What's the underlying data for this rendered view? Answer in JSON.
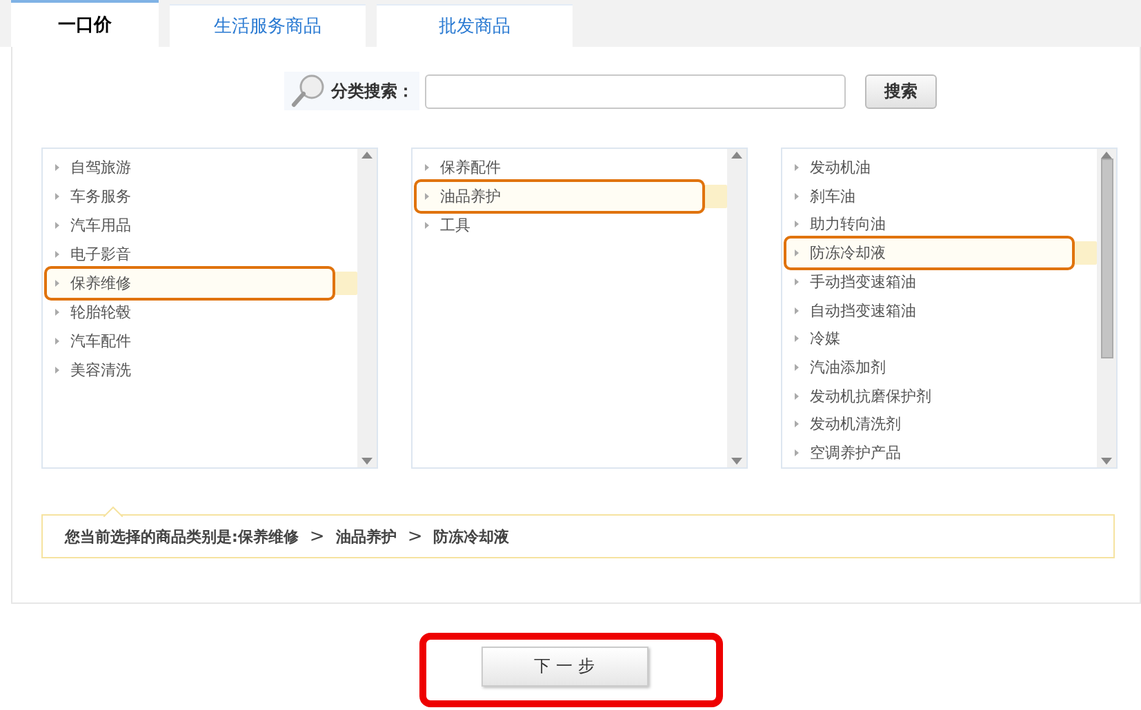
{
  "tabs": [
    {
      "label": "一口价",
      "selected": true
    },
    {
      "label": "生活服务商品",
      "selected": false
    },
    {
      "label": "批发商品",
      "selected": false
    }
  ],
  "search": {
    "label": "分类搜索：",
    "button": "搜索"
  },
  "columns": [
    {
      "scrollbar_thumb": false,
      "items": [
        {
          "label": "自驾旅游",
          "selected": false
        },
        {
          "label": "车务服务",
          "selected": false
        },
        {
          "label": "汽车用品",
          "selected": false
        },
        {
          "label": "电子影音",
          "selected": false
        },
        {
          "label": "保养维修",
          "selected": true
        },
        {
          "label": "轮胎轮毂",
          "selected": false
        },
        {
          "label": "汽车配件",
          "selected": false
        },
        {
          "label": "美容清洗",
          "selected": false
        }
      ]
    },
    {
      "scrollbar_thumb": false,
      "items": [
        {
          "label": "保养配件",
          "selected": false
        },
        {
          "label": "油品养护",
          "selected": true
        },
        {
          "label": "工具",
          "selected": false
        }
      ]
    },
    {
      "scrollbar_thumb": true,
      "items": [
        {
          "label": "发动机油",
          "selected": false
        },
        {
          "label": "刹车油",
          "selected": false
        },
        {
          "label": "助力转向油",
          "selected": false
        },
        {
          "label": "防冻冷却液",
          "selected": true
        },
        {
          "label": "手动挡变速箱油",
          "selected": false
        },
        {
          "label": "自动挡变速箱油",
          "selected": false
        },
        {
          "label": "冷媒",
          "selected": false
        },
        {
          "label": "汽油添加剂",
          "selected": false
        },
        {
          "label": "发动机抗磨保护剂",
          "selected": false
        },
        {
          "label": "发动机清洗剂",
          "selected": false
        },
        {
          "label": "空调养护产品",
          "selected": false
        }
      ]
    }
  ],
  "breadcrumb": [
    {
      "kind": "label",
      "text": "您当前选择的商品类别是:"
    },
    {
      "kind": "category",
      "text": "保养维修"
    },
    {
      "kind": "separator",
      "text": ">"
    },
    {
      "kind": "category",
      "text": "油品养护"
    },
    {
      "kind": "separator",
      "text": ">"
    },
    {
      "kind": "category",
      "text": "防冻冷却液"
    }
  ],
  "next_button": {
    "label": "下 一 步",
    "highlighted": true
  }
}
